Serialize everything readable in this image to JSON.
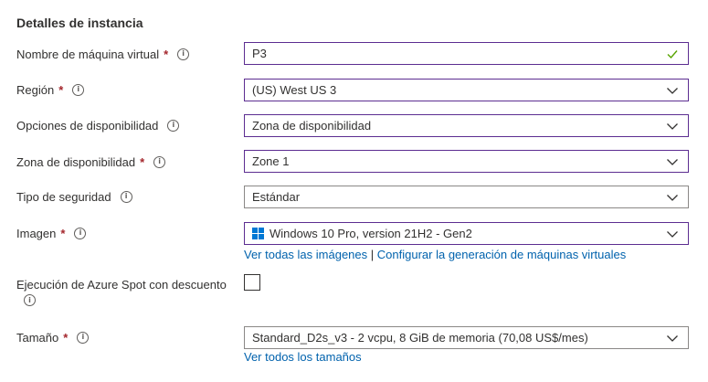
{
  "section": {
    "title": "Detalles de instancia"
  },
  "fields": {
    "vm_name": {
      "label": "Nombre de máquina virtual",
      "value": "P3"
    },
    "region": {
      "label": "Región",
      "value": "(US) West US 3"
    },
    "availability_options": {
      "label": "Opciones de disponibilidad",
      "value": "Zona de disponibilidad"
    },
    "availability_zone": {
      "label": "Zona de disponibilidad",
      "value": "Zone 1"
    },
    "security_type": {
      "label": "Tipo de seguridad",
      "value": "Estándar"
    },
    "image": {
      "label": "Imagen",
      "value": "Windows 10 Pro, version 21H2 - Gen2",
      "link_all_images": "Ver todas las imágenes",
      "link_separator": "|",
      "link_configure": "Configurar la generación de máquinas virtuales"
    },
    "spot": {
      "label": "Ejecución de Azure Spot con descuento",
      "checked": false
    },
    "size": {
      "label": "Tamaño",
      "value": "Standard_D2s_v3 - 2 vcpu, 8 GiB de memoria (70,08 US$/mes)",
      "link_all_sizes": "Ver todos los tamaños"
    }
  },
  "required_marker": "*",
  "info_glyph": "i",
  "colors": {
    "accent_border": "#5c2d91",
    "link": "#0062ad",
    "required": "#a4262c",
    "valid_check": "#57a300",
    "windows_logo": "#0078d4"
  }
}
